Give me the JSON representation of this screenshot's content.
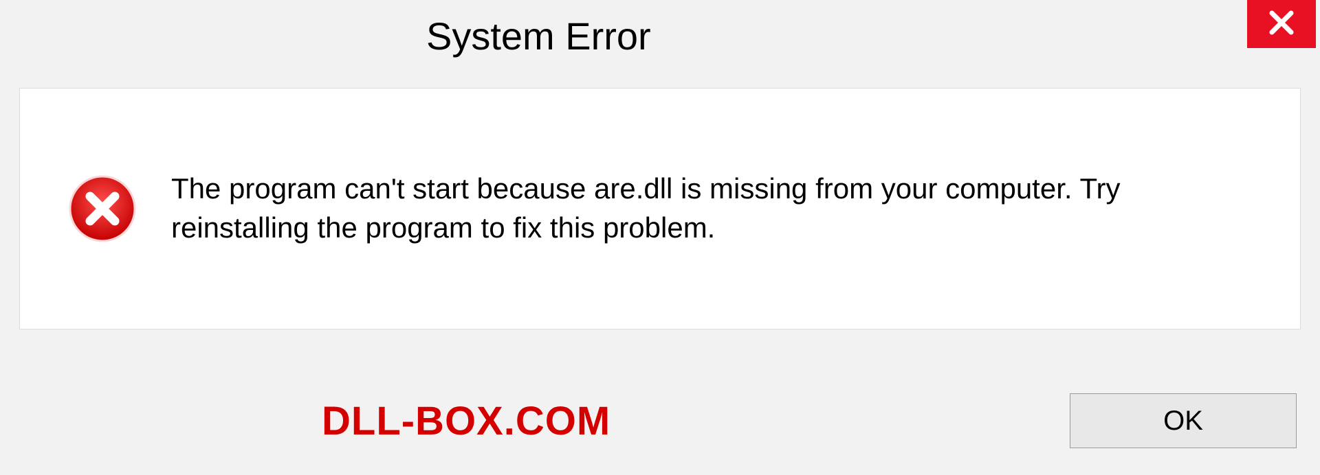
{
  "dialog": {
    "title": "System Error",
    "message": "The program can't start because are.dll is missing from your computer. Try reinstalling the program to fix this problem.",
    "ok_label": "OK"
  },
  "watermark": "DLL-BOX.COM",
  "colors": {
    "error_red": "#d40000",
    "close_red": "#e81123"
  }
}
